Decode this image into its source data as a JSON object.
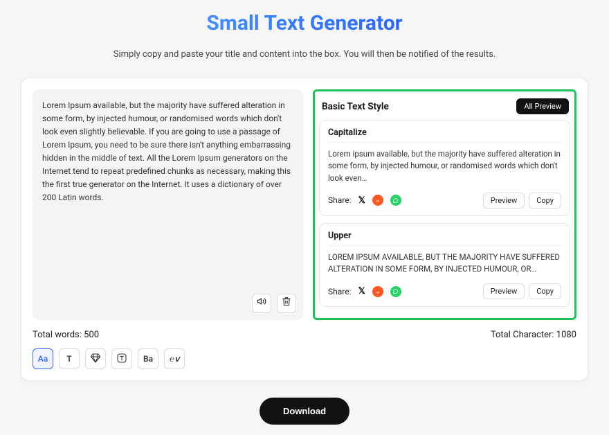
{
  "title": "Small Text Generator",
  "subtitle": "Simply copy and paste your title and content into the box. You will then be notified of the results.",
  "editor_text": "Lorem Ipsum available, but the majority have suffered alteration in some form, by injected humour, or randomised words which don't look even slightly believable. If you are going to use a passage of Lorem Ipsum, you need to be sure there isn't anything embarrassing hidden in the middle of text. All the Lorem Ipsum generators on the Internet tend to repeat predefined chunks as necessary, making this the first true generator on the Internet. It uses a dictionary of over 200 Latin words.",
  "results": {
    "section_label": "Basic Text Style",
    "all_preview_btn": "All Preview",
    "share_label": "Share:",
    "preview_btn": "Preview",
    "copy_btn": "Copy",
    "items": [
      {
        "name": "Capitalize",
        "sample": "Lorem ipsum available, but the majority have suffered alteration in some form, by injected humour, or randomised words which don't look even…"
      },
      {
        "name": "Upper",
        "sample": "LOREM IPSUM AVAILABLE, BUT THE MAJORITY HAVE SUFFERED ALTERATION IN SOME FORM, BY INJECTED HUMOUR, OR…"
      }
    ]
  },
  "stats": {
    "words_label": "Total words: ",
    "words_value": "500",
    "chars_label": "Total Character: ",
    "chars_value": "1080"
  },
  "modes": [
    {
      "key": "aa",
      "label": "Aa",
      "active": true
    },
    {
      "key": "t",
      "label": "T",
      "active": false
    },
    {
      "key": "diamond",
      "label": "",
      "active": false
    },
    {
      "key": "circle-t",
      "label": "",
      "active": false
    },
    {
      "key": "ba",
      "label": "Ba",
      "active": false
    },
    {
      "key": "ev",
      "label": "℮ⅴ",
      "active": false
    }
  ],
  "download_btn": "Download"
}
